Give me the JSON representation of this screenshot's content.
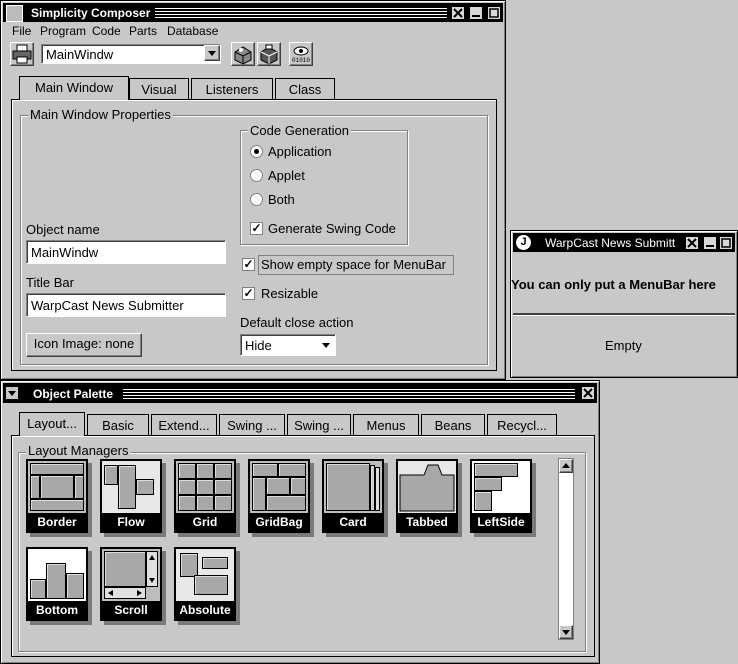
{
  "composer": {
    "title": "Simplicity Composer",
    "menu": [
      "File",
      "Program",
      "Code",
      "Parts",
      "Database"
    ],
    "toolbar": {
      "selected_object": "MainWindw",
      "icons": [
        "print-icon",
        "build-icon",
        "deploy-icon",
        "view-binary-icon"
      ],
      "view_binary_glyph": "01010"
    },
    "tabs": [
      "Main Window",
      "Visual",
      "Listeners",
      "Class"
    ],
    "active_tab": "Main Window",
    "panel": {
      "group_title": "Main Window Properties",
      "object_name_label": "Object name",
      "object_name_value": "MainWindw",
      "title_bar_label": "Title Bar",
      "title_bar_value": "WarpCast News Submitter",
      "icon_button": "Icon Image: none",
      "code_generation": {
        "title": "Code Generation",
        "options": [
          "Application",
          "Applet",
          "Both"
        ],
        "selected": "Application",
        "generate_swing_label": "Generate Swing Code",
        "generate_swing_checked": true
      },
      "show_empty_label": "Show empty space for MenuBar",
      "show_empty_checked": true,
      "resizable_label": "Resizable",
      "resizable_checked": true,
      "default_close_label": "Default close action",
      "default_close_value": "Hide"
    }
  },
  "preview": {
    "title": "WarpCast News Submitt",
    "app_icon_letter": "J",
    "menubar_message": "You can only put a MenuBar here",
    "body_text": "Empty"
  },
  "palette": {
    "title": "Object Palette",
    "tabs": [
      "Layout...",
      "Basic",
      "Extend...",
      "Swing ...",
      "Swing ...",
      "Menus",
      "Beans",
      "Recycl..."
    ],
    "active_tab": "Layout...",
    "group_title": "Layout Managers",
    "managers": [
      "Border",
      "Flow",
      "Grid",
      "GridBag",
      "Card",
      "Tabbed",
      "LeftSide",
      "Bottom",
      "Scroll",
      "Absolute"
    ]
  },
  "colors": {
    "window_bg": "#c8c8c8",
    "title_bar": "#000000",
    "field_bg": "#ffffff"
  }
}
